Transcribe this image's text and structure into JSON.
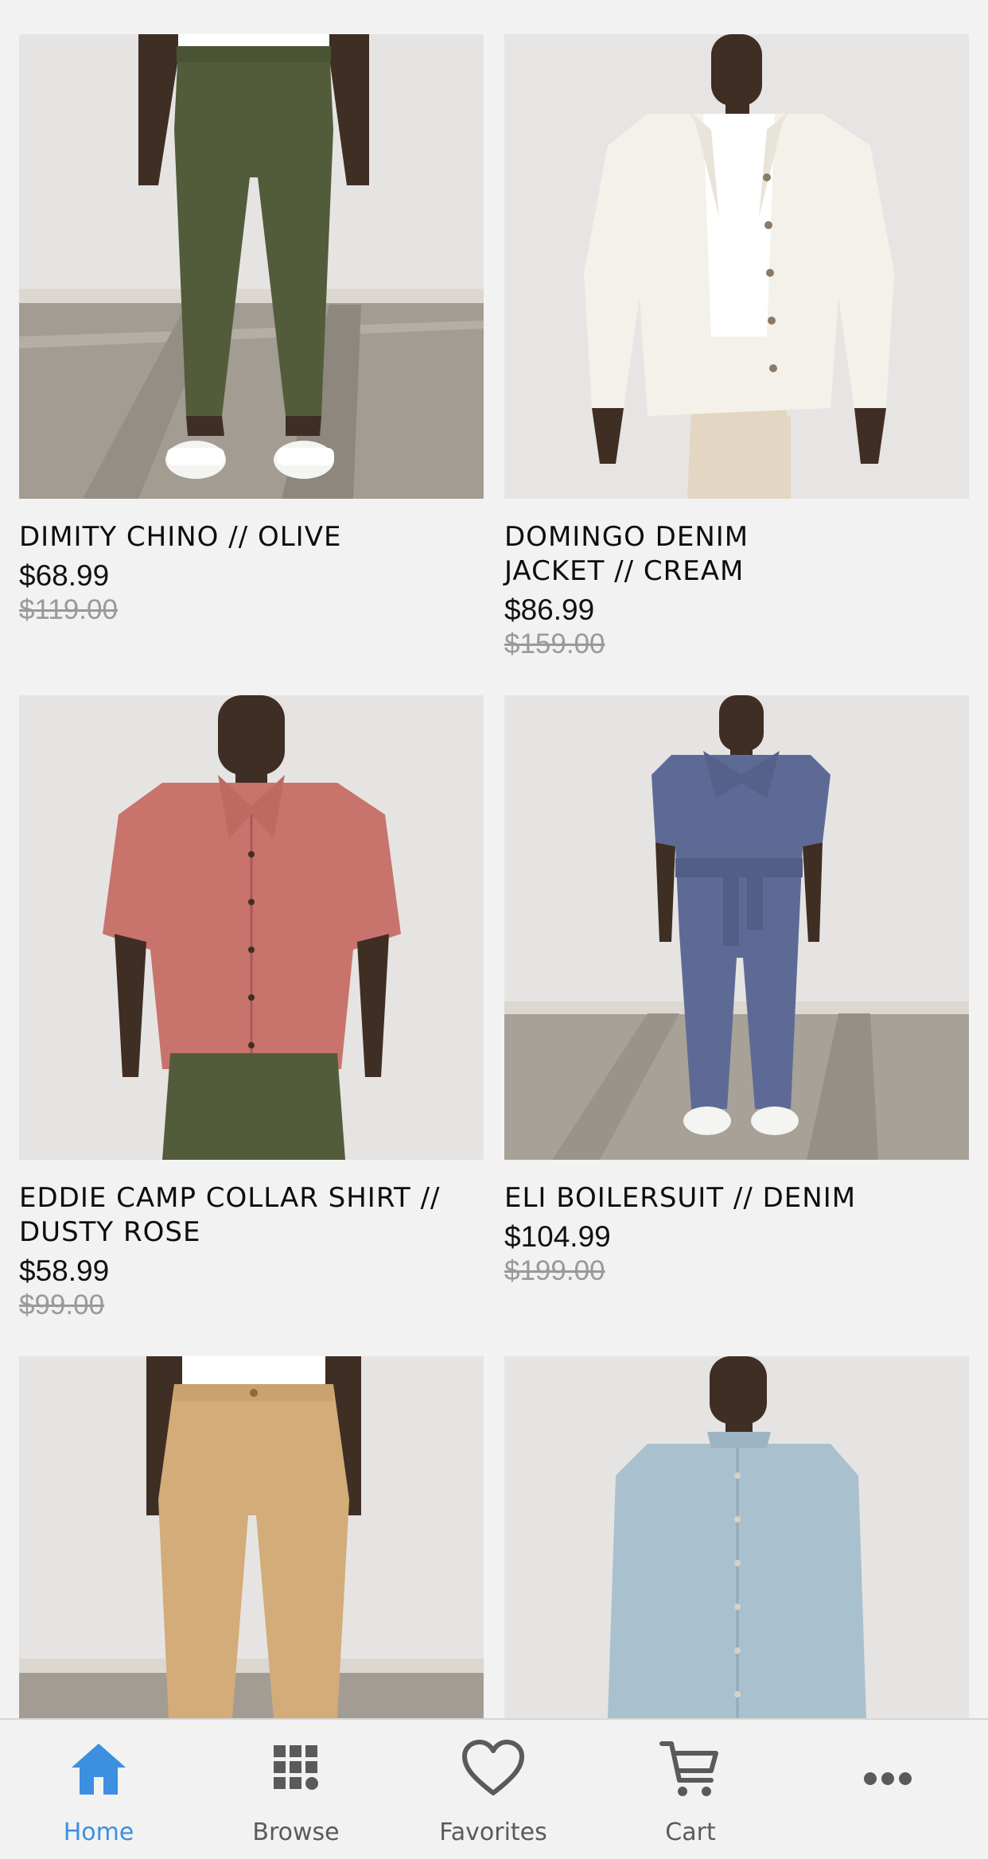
{
  "products": [
    {
      "name": "DIMITY CHINO // OLIVE",
      "price": "$68.99",
      "old_price": "$119.00",
      "image": "olive-chino-photo"
    },
    {
      "name": "DOMINGO DENIM JACKET // CREAM",
      "price": "$86.99",
      "old_price": "$159.00",
      "image": "cream-denim-jacket-photo"
    },
    {
      "name": "EDDIE CAMP COLLAR SHIRT // DUSTY ROSE",
      "price": "$58.99",
      "old_price": "$99.00",
      "image": "dusty-rose-shirt-photo"
    },
    {
      "name": "ELI BOILERSUIT // DENIM",
      "price": "$104.99",
      "old_price": "$199.00",
      "image": "denim-boilersuit-photo"
    },
    {
      "name": "",
      "price": "",
      "old_price": "",
      "image": "khaki-pants-photo"
    },
    {
      "name": "",
      "price": "",
      "old_price": "",
      "image": "light-blue-shirt-photo"
    }
  ],
  "tabbar": {
    "items": [
      {
        "label": "Home",
        "icon": "home-icon",
        "active": true
      },
      {
        "label": "Browse",
        "icon": "grid-icon",
        "active": false
      },
      {
        "label": "Favorites",
        "icon": "heart-icon",
        "active": false
      },
      {
        "label": "Cart",
        "icon": "cart-icon",
        "active": false
      },
      {
        "label": "",
        "icon": "more-icon",
        "active": false
      }
    ]
  },
  "colors": {
    "accent": "#3d8fe0",
    "background": "#f2f2f2",
    "old_price": "#9a9a9a"
  }
}
